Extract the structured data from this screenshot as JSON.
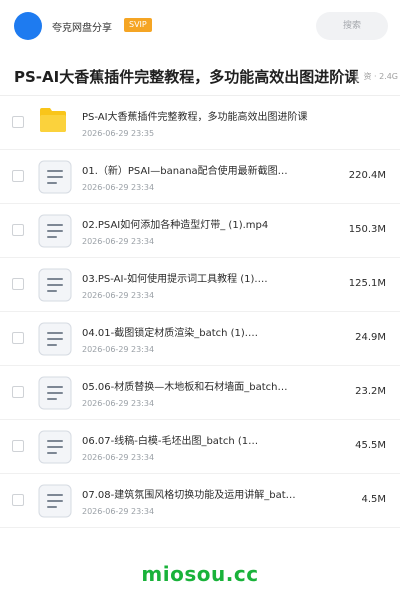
{
  "header": {
    "brand": "夸克网盘分享",
    "badge": "SVIP",
    "search_placeholder": "搜索"
  },
  "share": {
    "title": "PS-AI大香蕉插件完整教程，多功能高效出图进阶课",
    "meta": "资 · 2.4G"
  },
  "items": [
    {
      "type": "folder",
      "name": "PS-AI大香蕉插件完整教程，多功能高效出图进阶课",
      "date": "2026-06-29 23:35",
      "size": ""
    },
    {
      "type": "file",
      "name": "01.（新）PSAI—banana配合使用最新截图…",
      "date": "2026-06-29 23:34",
      "size": "220.4M"
    },
    {
      "type": "file",
      "name": "02.PSAI如何添加各种造型灯带_ (1).mp4",
      "date": "2026-06-29 23:34",
      "size": "150.3M"
    },
    {
      "type": "file",
      "name": "03.PS-AI-如何使用提示词工具教程 (1).…",
      "date": "2026-06-29 23:34",
      "size": "125.1M"
    },
    {
      "type": "file",
      "name": "04.01-截图锁定材质渲染_batch (1).…",
      "date": "2026-06-29 23:34",
      "size": "24.9M"
    },
    {
      "type": "file",
      "name": "05.06-材质替换—木地板和石材墙面_batch…",
      "date": "2026-06-29 23:34",
      "size": "23.2M"
    },
    {
      "type": "file",
      "name": "06.07-线稿-白模-毛坯出图_batch (1…",
      "date": "2026-06-29 23:34",
      "size": "45.5M"
    },
    {
      "type": "file",
      "name": "07.08-建筑氛围风格切换功能及运用讲解_bat…",
      "date": "2026-06-29 23:34",
      "size": "4.5M"
    }
  ],
  "watermark": "miosou.cc",
  "colors": {
    "avatar": "#1e7bf0",
    "badge": "#f5a524",
    "folder": "#f9c51a",
    "watermark": "#19b23a"
  }
}
